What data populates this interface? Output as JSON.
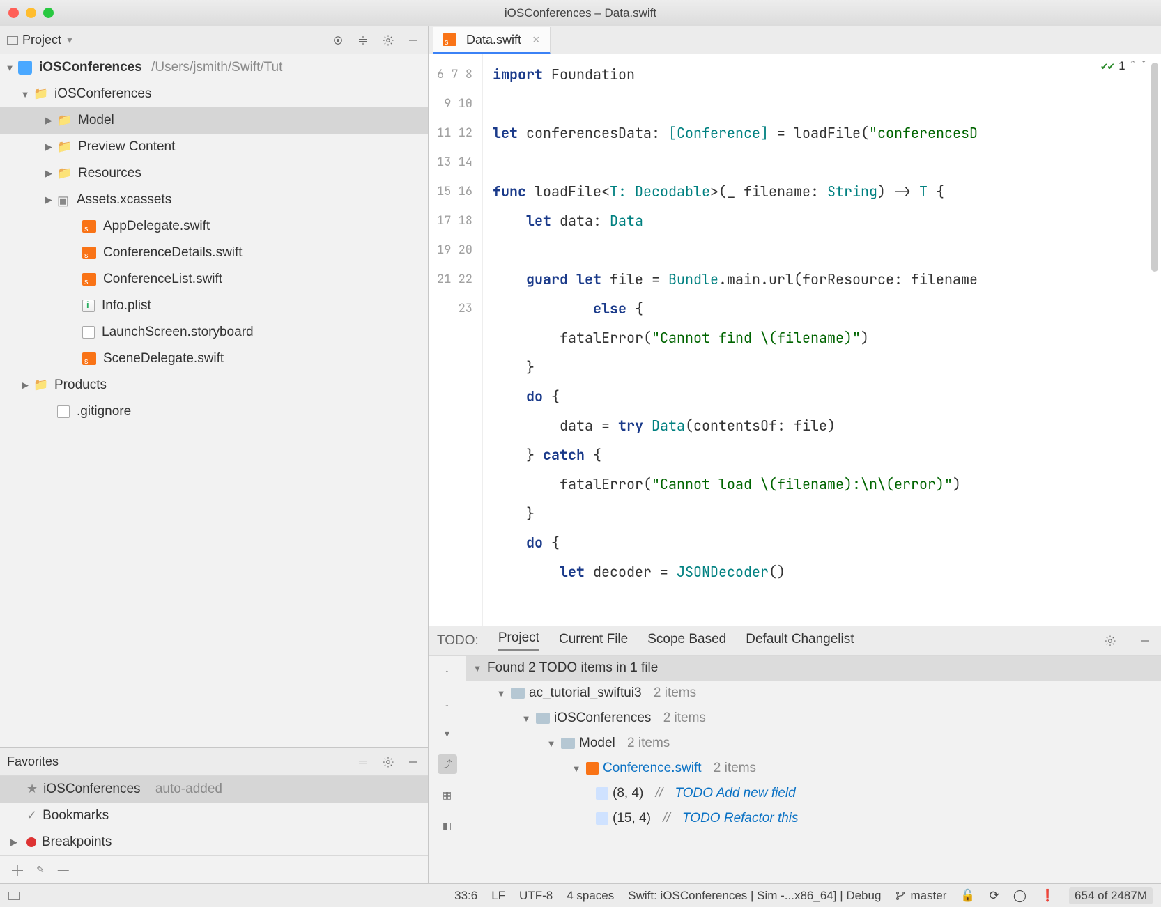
{
  "window": {
    "title": "iOSConferences – Data.swift"
  },
  "projectPanel": {
    "title": "Project",
    "root": {
      "name": "iOSConferences",
      "path": "/Users/jsmith/Swift/Tut"
    },
    "tree": [
      {
        "label": "iOSConferences"
      },
      {
        "label": "Model"
      },
      {
        "label": "Preview Content"
      },
      {
        "label": "Resources"
      },
      {
        "label": "Assets.xcassets"
      },
      {
        "label": "AppDelegate.swift"
      },
      {
        "label": "ConferenceDetails.swift"
      },
      {
        "label": "ConferenceList.swift"
      },
      {
        "label": "Info.plist"
      },
      {
        "label": "LaunchScreen.storyboard"
      },
      {
        "label": "SceneDelegate.swift"
      },
      {
        "label": "Products"
      },
      {
        "label": ".gitignore"
      }
    ]
  },
  "favoritesPanel": {
    "title": "Favorites",
    "items": [
      {
        "label": "iOSConferences",
        "suffix": "auto-added"
      },
      {
        "label": "Bookmarks"
      },
      {
        "label": "Breakpoints"
      }
    ]
  },
  "editor": {
    "tab": {
      "label": "Data.swift"
    },
    "inspection": {
      "count": "1"
    },
    "firstLine": 6,
    "lines": [
      [
        [
          "kw",
          "import"
        ],
        [
          "id",
          " Foundation"
        ]
      ],
      [
        [
          "id",
          ""
        ]
      ],
      [
        [
          "kw",
          "let"
        ],
        [
          "id",
          " conferencesData: "
        ],
        [
          "tp",
          "[Conference]"
        ],
        [
          "id",
          " = loadFile("
        ],
        [
          "str",
          "\"conferencesD"
        ]
      ],
      [
        [
          "id",
          ""
        ]
      ],
      [
        [
          "kw",
          "func"
        ],
        [
          "id",
          " loadFile<"
        ],
        [
          "tp",
          "T: Decodable"
        ],
        [
          "id",
          ">(_ filename: "
        ],
        [
          "tp",
          "String"
        ],
        [
          "id",
          ") -> "
        ],
        [
          "tp",
          "T"
        ],
        [
          "id",
          " {"
        ]
      ],
      [
        [
          "id",
          "    "
        ],
        [
          "kw",
          "let"
        ],
        [
          "id",
          " data: "
        ],
        [
          "tp",
          "Data"
        ]
      ],
      [
        [
          "id",
          ""
        ]
      ],
      [
        [
          "id",
          "    "
        ],
        [
          "kw",
          "guard let"
        ],
        [
          "id",
          " file = "
        ],
        [
          "tp",
          "Bundle"
        ],
        [
          "id",
          ".main.url(forResource: filename"
        ]
      ],
      [
        [
          "id",
          "            "
        ],
        [
          "kw",
          "else"
        ],
        [
          "id",
          " {"
        ]
      ],
      [
        [
          "id",
          "        fatalError("
        ],
        [
          "str",
          "\"Cannot find \\(filename)\""
        ],
        [
          "id",
          ")"
        ]
      ],
      [
        [
          "id",
          "    }"
        ]
      ],
      [
        [
          "id",
          "    "
        ],
        [
          "kw",
          "do"
        ],
        [
          "id",
          " {"
        ]
      ],
      [
        [
          "id",
          "        data = "
        ],
        [
          "kw",
          "try"
        ],
        [
          "id",
          " "
        ],
        [
          "tp",
          "Data"
        ],
        [
          "id",
          "(contentsOf: file)"
        ]
      ],
      [
        [
          "id",
          "    } "
        ],
        [
          "kw",
          "catch"
        ],
        [
          "id",
          " {"
        ]
      ],
      [
        [
          "id",
          "        fatalError("
        ],
        [
          "str",
          "\"Cannot load \\(filename):\\n\\(error)\""
        ],
        [
          "id",
          ")"
        ]
      ],
      [
        [
          "id",
          "    }"
        ]
      ],
      [
        [
          "id",
          "    "
        ],
        [
          "kw",
          "do"
        ],
        [
          "id",
          " {"
        ]
      ],
      [
        [
          "id",
          "        "
        ],
        [
          "kw",
          "let"
        ],
        [
          "id",
          " decoder = "
        ],
        [
          "tp",
          "JSONDecoder"
        ],
        [
          "id",
          "()"
        ]
      ]
    ]
  },
  "todo": {
    "label": "TODO:",
    "tabs": [
      "Project",
      "Current File",
      "Scope Based",
      "Default Changelist"
    ],
    "activeTab": 0,
    "summary": "Found 2 TODO items in 1 file",
    "tree": {
      "module": {
        "name": "ac_tutorial_swiftui3",
        "count": "2 items"
      },
      "project": {
        "name": "iOSConferences",
        "count": "2 items"
      },
      "folder": {
        "name": "Model",
        "count": "2 items"
      },
      "file": {
        "name": "Conference.swift",
        "count": "2 items"
      },
      "items": [
        {
          "loc": "(8, 4)",
          "sep": "//",
          "text": "TODO Add new field"
        },
        {
          "loc": "(15, 4)",
          "sep": "//",
          "text": "TODO Refactor this"
        }
      ]
    }
  },
  "statusbar": {
    "caret": "33:6",
    "lineSep": "LF",
    "encoding": "UTF-8",
    "indent": "4 spaces",
    "config": "Swift: iOSConferences | Sim -...x86_64] | Debug",
    "vcs": "master",
    "memory": "654 of 2487M"
  }
}
